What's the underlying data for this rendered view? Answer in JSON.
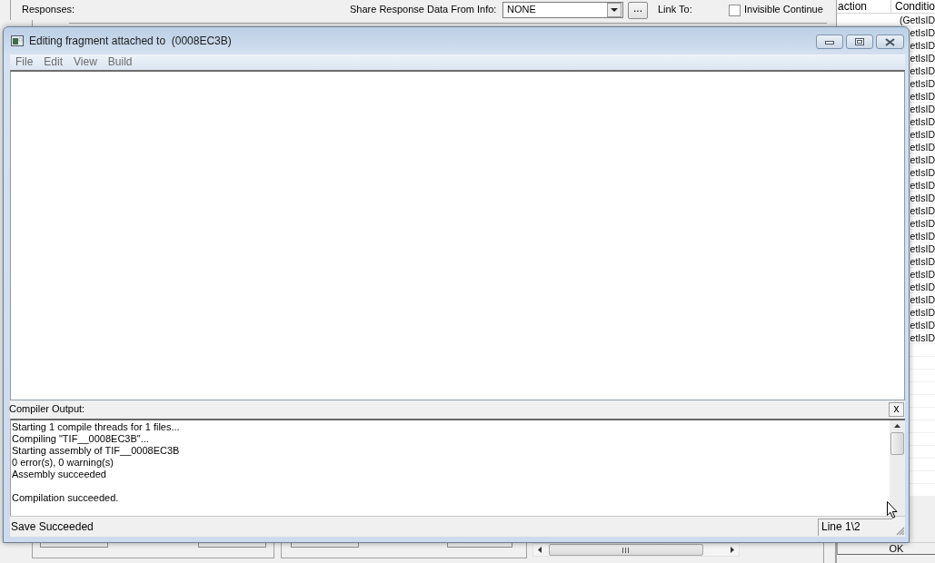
{
  "background": {
    "responses_label": "Responses:",
    "share_label": "Share Response Data From Info:",
    "share_dropdown": {
      "value": "NONE"
    },
    "browse_button": "...",
    "link_to_label": "Link To:",
    "invisible_continue": {
      "label": "Invisible Continue",
      "checked": false
    },
    "table": {
      "columns": [
        "action",
        "Conditio"
      ],
      "rows": [
        {
          "column_2": "(GetIsID"
        },
        {
          "column_2": "etIsID"
        },
        {
          "column_2": "etIsID"
        },
        {
          "column_2": "etIsID"
        },
        {
          "column_2": "etIsID"
        },
        {
          "column_2": "etIsID"
        },
        {
          "column_2": "etIsID"
        },
        {
          "column_2": "etIsID"
        },
        {
          "column_2": "etIsID"
        },
        {
          "column_2": "etIsID"
        },
        {
          "column_2": "etIsID"
        },
        {
          "column_2": "etIsID"
        },
        {
          "column_2": "etIsID"
        },
        {
          "column_2": "etIsID"
        },
        {
          "column_2": "etIsID"
        },
        {
          "column_2": "etIsID"
        },
        {
          "column_2": "etIsID"
        },
        {
          "column_2": "etIsID"
        },
        {
          "column_2": "etIsID"
        },
        {
          "column_2": "etIsID"
        },
        {
          "column_2": "etIsID"
        },
        {
          "column_2": "etIsID"
        },
        {
          "column_2": "etIsID"
        },
        {
          "column_2": "etIsID"
        },
        {
          "column_2": "etIsID"
        },
        {
          "column_2": "etIsID"
        }
      ]
    },
    "ok_button": "OK"
  },
  "window": {
    "title": "Editing fragment attached to  (0008EC3B)",
    "menu": [
      "File",
      "Edit",
      "View",
      "Build"
    ],
    "compiler_output": {
      "label": "Compiler Output:",
      "close_button": "x",
      "blocks": [
        [
          "Starting 1 compile threads for 1 files...",
          "Compiling \"TIF__0008EC3B\"...",
          "Starting assembly of TIF__0008EC3B",
          "0 error(s), 0 warning(s)",
          "Assembly succeeded"
        ],
        [
          "Compilation succeeded."
        ]
      ]
    },
    "status_bar": {
      "message": "Save Succeeded",
      "position": "Line 1\\2"
    }
  }
}
